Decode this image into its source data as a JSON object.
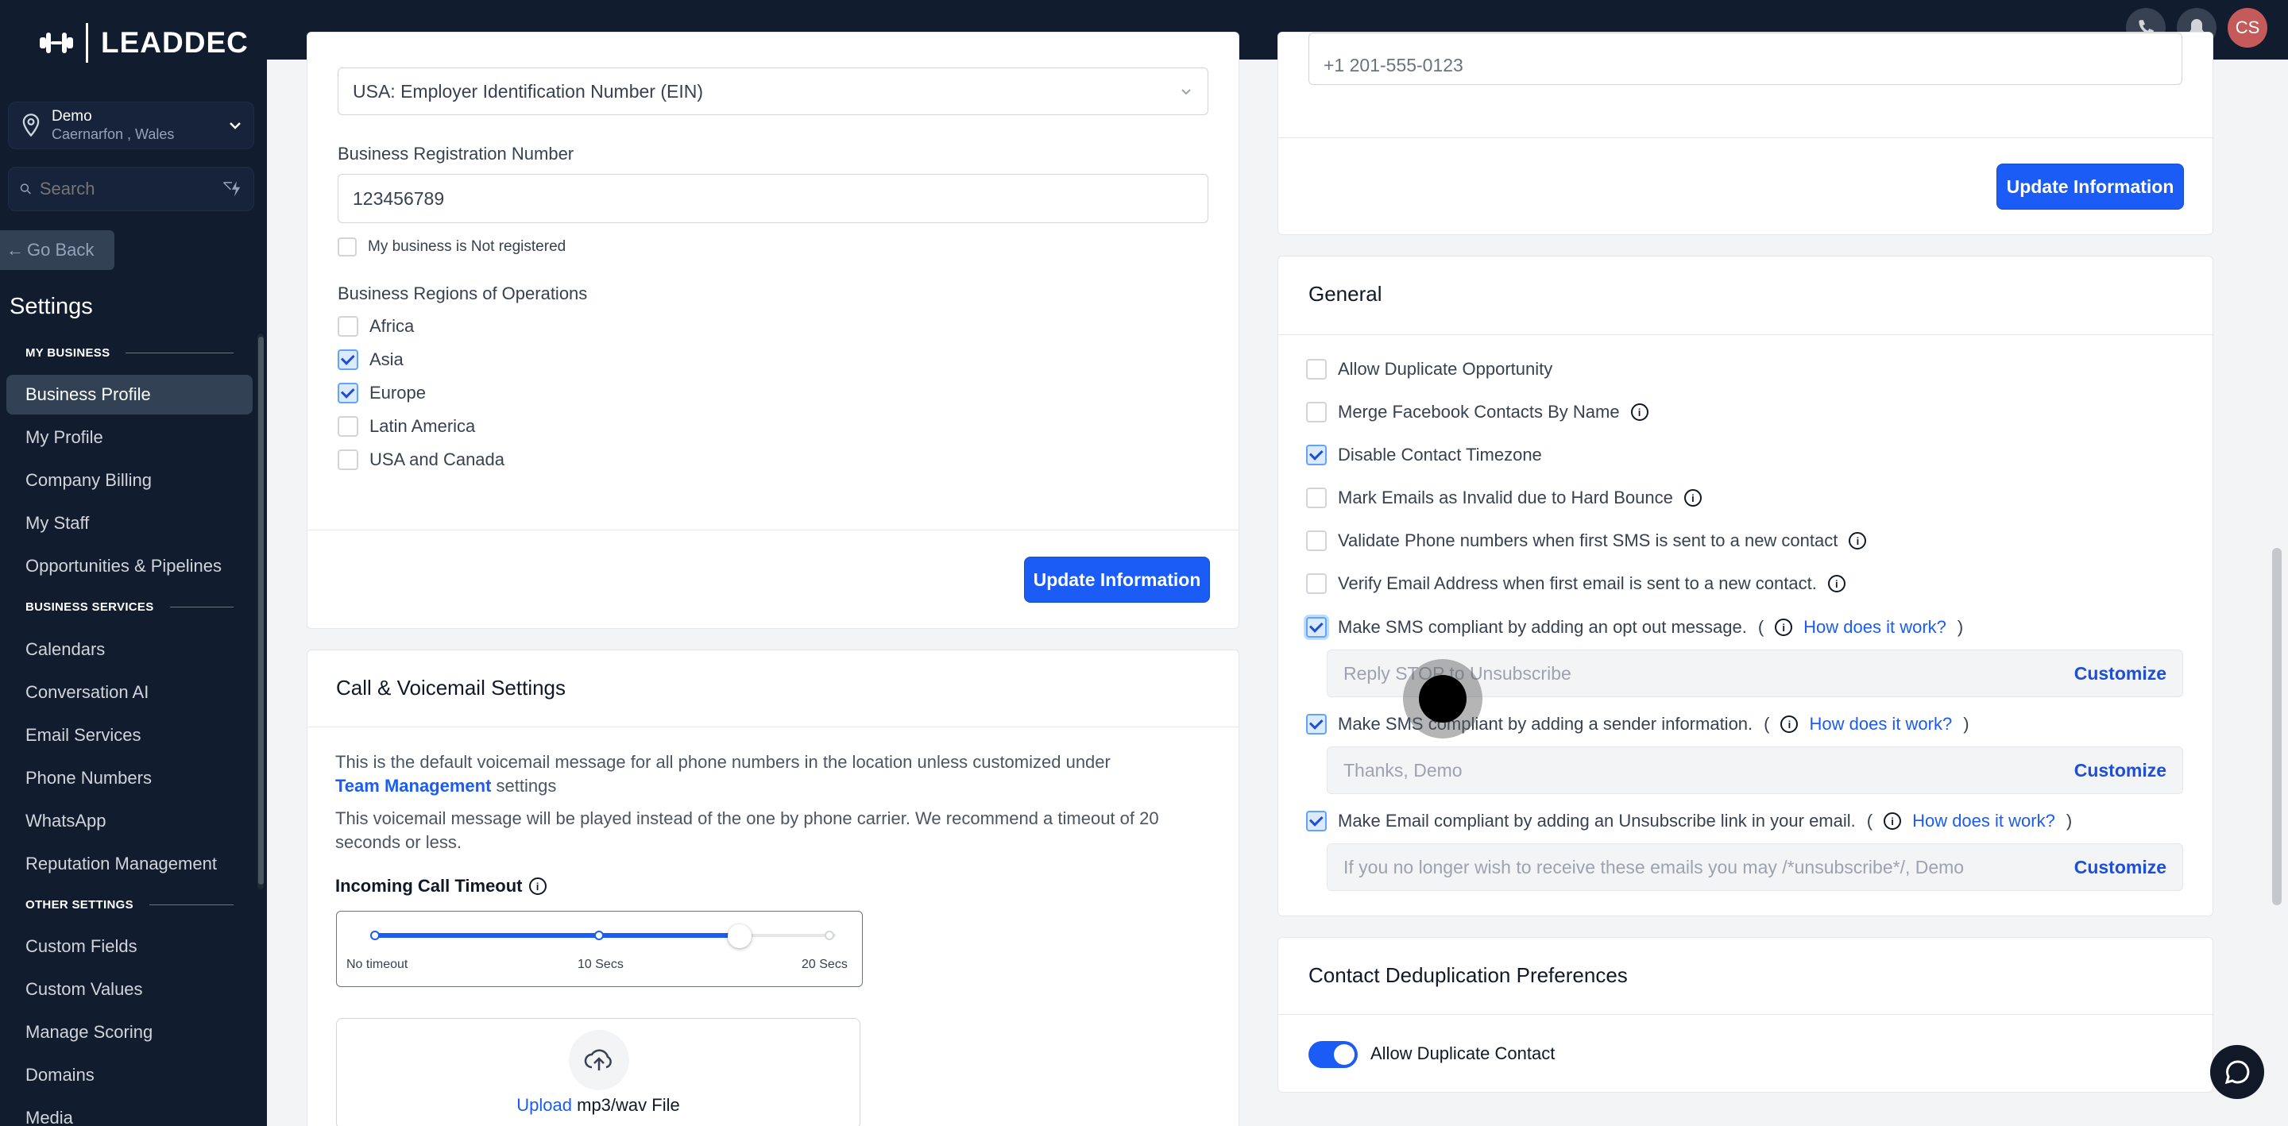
{
  "app": {
    "logo_text": "LEADDEC"
  },
  "sidebar": {
    "location": {
      "name": "Demo",
      "sub": "Caernarfon , Wales"
    },
    "search_placeholder": "Search",
    "go_back": "Go Back",
    "settings_title": "Settings",
    "sections": [
      {
        "label": "MY BUSINESS",
        "items": [
          "Business Profile",
          "My Profile",
          "Company Billing",
          "My Staff",
          "Opportunities & Pipelines"
        ]
      },
      {
        "label": "BUSINESS SERVICES",
        "items": [
          "Calendars",
          "Conversation AI",
          "Email Services",
          "Phone Numbers",
          "WhatsApp",
          "Reputation Management"
        ]
      },
      {
        "label": "OTHER SETTINGS",
        "items": [
          "Custom Fields",
          "Custom Values",
          "Manage Scoring",
          "Domains",
          "Media"
        ]
      }
    ],
    "active_item": "Business Profile"
  },
  "topbar": {
    "avatar_initials": "CS"
  },
  "business_info": {
    "id_type_value": "USA: Employer Identification Number (EIN)",
    "reg_number_label": "Business Registration Number",
    "reg_number_value": "123456789",
    "not_registered_label": "My business is Not registered",
    "regions_label": "Business Regions of Operations",
    "regions": [
      {
        "label": "Africa",
        "checked": false
      },
      {
        "label": "Asia",
        "checked": true
      },
      {
        "label": "Europe",
        "checked": true
      },
      {
        "label": "Latin America",
        "checked": false
      },
      {
        "label": "USA and Canada",
        "checked": false
      }
    ],
    "update_button": "Update Information"
  },
  "call_voicemail": {
    "title": "Call & Voicemail Settings",
    "desc1_prefix": "This is the default voicemail message for all phone numbers in the location unless customized under",
    "desc1_link": "Team Management",
    "desc1_suffix": "settings",
    "desc2_line1": "This voicemail message will be played instead of the one by phone carrier. We recommend a timeout of 20",
    "desc2_line2": "seconds or less.",
    "timeout_label": "Incoming Call Timeout",
    "slider_labels": [
      "No timeout",
      "10 Secs",
      "20 Secs"
    ],
    "upload_link": "Upload",
    "upload_text": "mp3/wav File"
  },
  "phone_card": {
    "phone_value": "+1 201-555-0123",
    "update_button": "Update Information"
  },
  "general": {
    "title": "General",
    "options": [
      {
        "label": "Allow Duplicate Opportunity",
        "checked": false,
        "info": false
      },
      {
        "label": "Merge Facebook Contacts By Name",
        "checked": false,
        "info": true
      },
      {
        "label": "Disable Contact Timezone",
        "checked": true,
        "info": false
      },
      {
        "label": "Mark Emails as Invalid due to Hard Bounce",
        "checked": false,
        "info": true
      },
      {
        "label": "Validate Phone numbers when first SMS is sent to a new contact",
        "checked": false,
        "info": true
      },
      {
        "label": "Verify Email Address when first email is sent to a new contact.",
        "checked": false,
        "info": true
      }
    ],
    "compliance": [
      {
        "label": "Make SMS compliant by adding an opt out message.",
        "link": "How does it work?",
        "field": "Reply STOP to Unsubscribe",
        "customize": "Customize"
      },
      {
        "label": "Make SMS compliant by adding a sender information.",
        "link": "How does it work?",
        "field": "Thanks, Demo",
        "customize": "Customize"
      },
      {
        "label": "Make Email compliant by adding an Unsubscribe link in your email.",
        "link": "How does it work?",
        "field": "If you no longer wish to receive these emails you may /*unsubscribe*/, Demo",
        "customize": "Customize"
      }
    ]
  },
  "dedup": {
    "title": "Contact Deduplication Preferences",
    "toggle_label": "Allow Duplicate Contact",
    "toggle_on": true
  },
  "colors": {
    "primary": "#1a5cf5",
    "sidebar_bg": "#111c2e"
  }
}
